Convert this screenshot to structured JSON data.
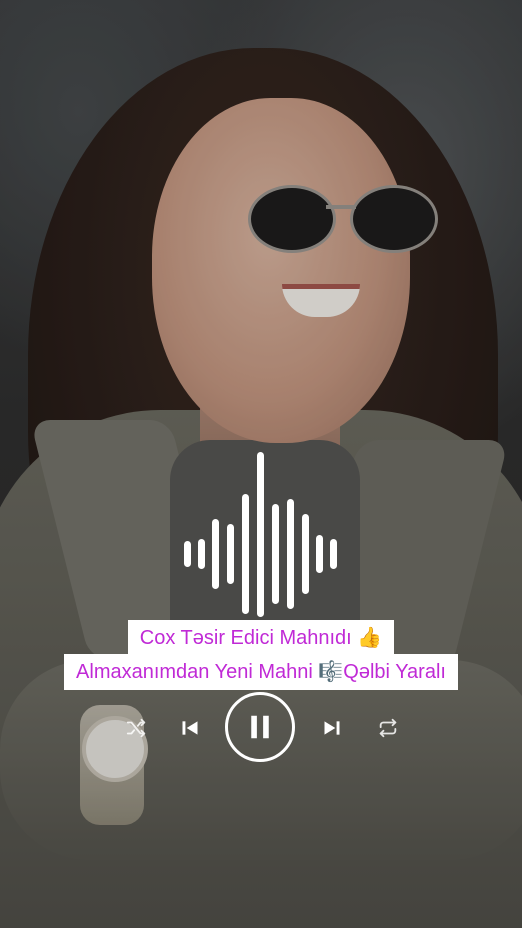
{
  "caption": {
    "line1": "Cox Təsir Edici Mahnıdı 👍",
    "line2": "Almaxanımdan Yeni Mahni 🎼Qəlbi Yaralı"
  },
  "player": {
    "state": "playing",
    "controls": [
      "shuffle-icon",
      "previous-icon",
      "pause-icon",
      "next-icon",
      "repeat-icon"
    ]
  },
  "colors": {
    "caption_text": "#c02ad6",
    "caption_bg": "#ffffff",
    "controls": "#ffffff"
  }
}
